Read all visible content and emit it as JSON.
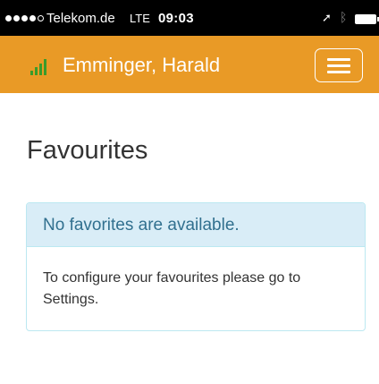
{
  "status_bar": {
    "carrier": "Telekom.de",
    "network": "LTE",
    "time": "09:03",
    "signal_bars_filled": 4,
    "signal_bars_total": 5
  },
  "header": {
    "user_name": "Emminger, Harald",
    "color": "#e99a26",
    "logo_color": "#3a9b2a"
  },
  "main": {
    "title": "Favourites",
    "panel": {
      "heading": "No favorites are available.",
      "body": "To configure your favourites please go to Settings.",
      "heading_color": "#31708f",
      "heading_bg": "#d9edf7"
    }
  },
  "icons": {
    "location": "location-arrow-icon",
    "bluetooth": "bluetooth-icon",
    "battery": "battery-icon",
    "menu": "hamburger-menu-icon",
    "logo": "signal-bars-logo-icon"
  }
}
